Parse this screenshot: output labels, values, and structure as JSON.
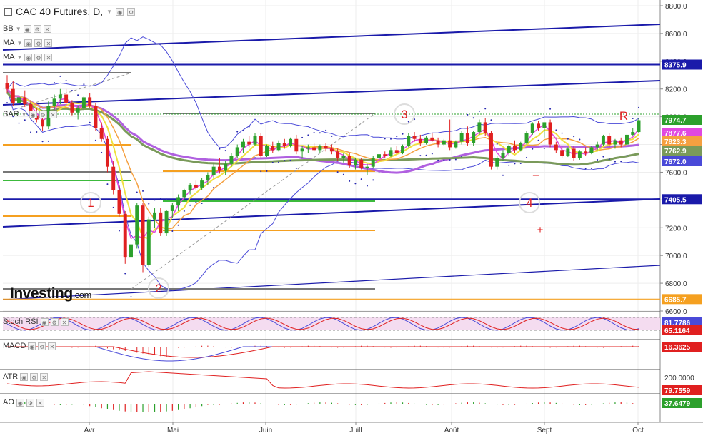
{
  "header": {
    "title": "CAC 40 Futures, D,"
  },
  "indicators_main": [
    {
      "label": "BB"
    },
    {
      "label": "MA"
    },
    {
      "label": "MA"
    },
    {
      "label": ""
    },
    {
      "label": ""
    },
    {
      "label": ""
    },
    {
      "label": "SAR"
    }
  ],
  "logo": {
    "brand": "Investing",
    "suffix": ".com"
  },
  "colors": {
    "up": "#2ca02c",
    "down": "#e02020",
    "channel": "#1a1aaa",
    "orange": "#f5a020",
    "green_hl": "#3cba3c",
    "bb": "#4a4ad8",
    "ma_magenta": "#e048e0",
    "ma_yellow": "#f0e040",
    "ma_orange": "#f5a040",
    "ma_purple": "#b060e0",
    "ma_olive": "#7a9a5a",
    "sar": "#2828b0",
    "stoch_bg": "#f4dcf0"
  },
  "chart_data": {
    "type": "candlestick",
    "title": "CAC 40 Futures, D,",
    "xlabel": "",
    "ylabel": "",
    "ylim": [
      6600,
      8800
    ],
    "y_ticks": [
      "8800.0",
      "8600.0",
      "8400.0",
      "8200.0",
      "8000.0",
      "7800.0",
      "7600.0",
      "7400.0",
      "7200.0",
      "7000.0",
      "6800.0",
      "6600.0"
    ],
    "x_ticks": [
      "Avr",
      "Mai",
      "Juin",
      "Juill",
      "Août",
      "Sept",
      "Oct"
    ],
    "ohlc": [
      [
        8240,
        8300,
        8170,
        8200
      ],
      [
        8200,
        8260,
        8080,
        8100
      ],
      [
        8100,
        8170,
        8040,
        8140
      ],
      [
        8140,
        8190,
        8070,
        8090
      ],
      [
        8090,
        8120,
        7990,
        8010
      ],
      [
        8010,
        8060,
        7960,
        7980
      ],
      [
        7980,
        8020,
        7900,
        7930
      ],
      [
        7930,
        8110,
        7910,
        8080
      ],
      [
        8080,
        8160,
        8040,
        8130
      ],
      [
        8130,
        8200,
        8090,
        8160
      ],
      [
        8160,
        8200,
        8080,
        8100
      ],
      [
        8100,
        8120,
        8010,
        8030
      ],
      [
        8030,
        8080,
        7980,
        8060
      ],
      [
        8060,
        8150,
        8040,
        8140
      ],
      [
        8140,
        8170,
        8060,
        8080
      ],
      [
        8080,
        8100,
        7900,
        7920
      ],
      [
        7920,
        7960,
        7820,
        7840
      ],
      [
        7840,
        7860,
        7600,
        7640
      ],
      [
        7640,
        7680,
        7440,
        7470
      ],
      [
        7470,
        7500,
        7280,
        7300
      ],
      [
        7300,
        7320,
        6940,
        6990
      ],
      [
        6990,
        7120,
        6780,
        7080
      ],
      [
        7080,
        7380,
        7050,
        7360
      ],
      [
        7360,
        7380,
        6880,
        6930
      ],
      [
        6930,
        7280,
        6920,
        7260
      ],
      [
        7260,
        7340,
        7200,
        7310
      ],
      [
        7310,
        7340,
        7140,
        7160
      ],
      [
        7160,
        7330,
        7140,
        7320
      ],
      [
        7320,
        7380,
        7270,
        7360
      ],
      [
        7360,
        7440,
        7320,
        7420
      ],
      [
        7420,
        7480,
        7390,
        7470
      ],
      [
        7470,
        7520,
        7440,
        7510
      ],
      [
        7510,
        7540,
        7470,
        7490
      ],
      [
        7490,
        7560,
        7470,
        7540
      ],
      [
        7540,
        7600,
        7510,
        7580
      ],
      [
        7580,
        7660,
        7560,
        7640
      ],
      [
        7640,
        7700,
        7590,
        7610
      ],
      [
        7610,
        7680,
        7580,
        7660
      ],
      [
        7660,
        7740,
        7640,
        7720
      ],
      [
        7720,
        7800,
        7700,
        7780
      ],
      [
        7780,
        7840,
        7740,
        7820
      ],
      [
        7820,
        7860,
        7780,
        7800
      ],
      [
        7800,
        7880,
        7790,
        7860
      ],
      [
        7860,
        7880,
        7700,
        7720
      ],
      [
        7720,
        7800,
        7710,
        7790
      ],
      [
        7790,
        7820,
        7740,
        7760
      ],
      [
        7760,
        7830,
        7750,
        7810
      ],
      [
        7810,
        7840,
        7770,
        7790
      ],
      [
        7790,
        7850,
        7780,
        7840
      ],
      [
        7840,
        7870,
        7730,
        7750
      ],
      [
        7750,
        7790,
        7700,
        7770
      ],
      [
        7770,
        7800,
        7740,
        7780
      ],
      [
        7780,
        7810,
        7750,
        7760
      ],
      [
        7760,
        7800,
        7740,
        7790
      ],
      [
        7790,
        7810,
        7750,
        7770
      ],
      [
        7770,
        7800,
        7730,
        7750
      ],
      [
        7750,
        7770,
        7680,
        7700
      ],
      [
        7700,
        7740,
        7670,
        7720
      ],
      [
        7720,
        7740,
        7630,
        7650
      ],
      [
        7650,
        7700,
        7620,
        7690
      ],
      [
        7690,
        7700,
        7620,
        7630
      ],
      [
        7630,
        7660,
        7580,
        7640
      ],
      [
        7640,
        7720,
        7630,
        7700
      ],
      [
        7700,
        7740,
        7690,
        7730
      ],
      [
        7730,
        7750,
        7700,
        7720
      ],
      [
        7720,
        7780,
        7710,
        7760
      ],
      [
        7760,
        7790,
        7730,
        7740
      ],
      [
        7740,
        7800,
        7730,
        7790
      ],
      [
        7790,
        7880,
        7780,
        7860
      ],
      [
        7860,
        7890,
        7820,
        7840
      ],
      [
        7840,
        7870,
        7790,
        7810
      ],
      [
        7810,
        7860,
        7800,
        7850
      ],
      [
        7850,
        7880,
        7820,
        7830
      ],
      [
        7830,
        7850,
        7780,
        7800
      ],
      [
        7800,
        7840,
        7790,
        7830
      ],
      [
        7830,
        7980,
        7760,
        7780
      ],
      [
        7780,
        7830,
        7770,
        7820
      ],
      [
        7820,
        7900,
        7800,
        7880
      ],
      [
        7880,
        7930,
        7790,
        7810
      ],
      [
        7810,
        7900,
        7790,
        7890
      ],
      [
        7890,
        7980,
        7870,
        7960
      ],
      [
        7960,
        7990,
        7860,
        7880
      ],
      [
        7880,
        7900,
        7620,
        7640
      ],
      [
        7640,
        7720,
        7620,
        7700
      ],
      [
        7700,
        7760,
        7680,
        7740
      ],
      [
        7740,
        7800,
        7720,
        7790
      ],
      [
        7790,
        7830,
        7740,
        7760
      ],
      [
        7760,
        7820,
        7750,
        7810
      ],
      [
        7810,
        7900,
        7800,
        7880
      ],
      [
        7880,
        7960,
        7870,
        7950
      ],
      [
        7950,
        7970,
        7900,
        7920
      ],
      [
        7920,
        7960,
        7850,
        7960
      ],
      [
        7960,
        7980,
        7780,
        7800
      ],
      [
        7800,
        7820,
        7740,
        7760
      ],
      [
        7760,
        7790,
        7700,
        7720
      ],
      [
        7720,
        7780,
        7710,
        7770
      ],
      [
        7770,
        7790,
        7680,
        7700
      ],
      [
        7700,
        7760,
        7690,
        7750
      ],
      [
        7750,
        7780,
        7720,
        7740
      ],
      [
        7740,
        7790,
        7730,
        7780
      ],
      [
        7780,
        7820,
        7760,
        7800
      ],
      [
        7800,
        7870,
        7790,
        7860
      ],
      [
        7860,
        7880,
        7780,
        7800
      ],
      [
        7800,
        7840,
        7770,
        7830
      ],
      [
        7830,
        7850,
        7780,
        7800
      ],
      [
        7800,
        7880,
        7790,
        7870
      ],
      [
        7870,
        7920,
        7860,
        7890
      ],
      [
        7890,
        7990,
        7880,
        7975
      ]
    ],
    "horizontal_lines": {
      "price_labels": [
        "8375.9",
        "7405.5",
        "6685.7"
      ],
      "levels": [
        8375.9,
        7405.5,
        6685.7
      ]
    },
    "price_tags": [
      {
        "label": "7974.7",
        "color": "#2ca02c"
      },
      {
        "label": "7877.6",
        "color": "#e048e0"
      },
      {
        "label": "7823.3",
        "color": "#f5a040"
      },
      {
        "label": "7762.9",
        "color": "#7a9a5a"
      },
      {
        "label": "7672.0",
        "color": "#4a4ad8"
      }
    ],
    "annotations": [
      {
        "text": "1"
      },
      {
        "text": "2"
      },
      {
        "text": "3"
      },
      {
        "text": "4"
      },
      {
        "text": "R"
      }
    ],
    "sub_panels": [
      {
        "name": "Stoch RSI",
        "values": [
          "81.7786",
          "65.1164"
        ]
      },
      {
        "name": "MACD",
        "values": [
          "16.3625"
        ]
      },
      {
        "name": "ATR",
        "values": [
          "200.0000",
          "79.7559"
        ]
      },
      {
        "name": "AO",
        "values": [
          "37.6479"
        ]
      }
    ]
  }
}
